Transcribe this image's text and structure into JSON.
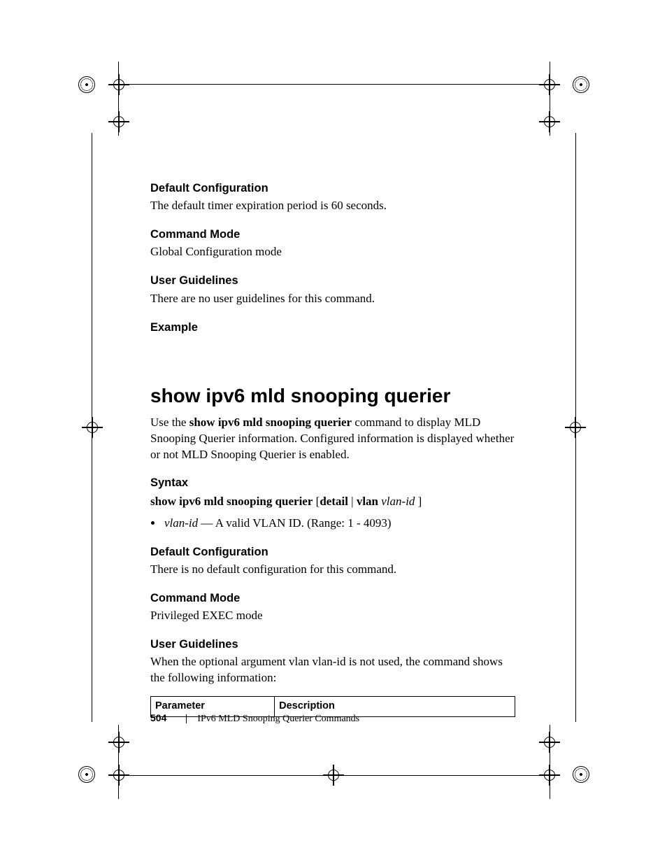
{
  "sections": {
    "default_cfg1_h": "Default Configuration",
    "default_cfg1_p": "The default timer expiration period is 60 seconds.",
    "cmd_mode1_h": "Command Mode",
    "cmd_mode1_p": "Global Configuration mode",
    "user_gl1_h": "User Guidelines",
    "user_gl1_p": "There are no user guidelines for this command.",
    "example_h": "Example"
  },
  "command": {
    "title": "show ipv6 mld snooping querier",
    "desc_pre": "Use the ",
    "desc_bold": "show ipv6 mld snooping querier",
    "desc_post": " command to display MLD Snooping Querier information. Configured information is displayed whether or not MLD Snooping Querier is enabled."
  },
  "syntax": {
    "heading": "Syntax",
    "line_bold1": "show ipv6 mld snooping querier",
    "line_plain1": " [",
    "line_bold2": "detail",
    "line_plain2": " | ",
    "line_bold3": "vlan",
    "line_plain3": " ",
    "line_ital": "vlan-id",
    "line_plain4": " ]",
    "bullet_term": "vlan-id",
    "bullet_dash": " — ",
    "bullet_rest": "A valid VLAN ID. (Range: 1 - 4093)"
  },
  "sections2": {
    "default_cfg2_h": "Default Configuration",
    "default_cfg2_p": "There is no default configuration for this command.",
    "cmd_mode2_h": "Command Mode",
    "cmd_mode2_p": "Privileged EXEC mode",
    "user_gl2_h": "User Guidelines",
    "user_gl2_p": "When the optional argument vlan vlan-id is not used, the command shows the following information:"
  },
  "table": {
    "col1": "Parameter",
    "col2": "Description"
  },
  "footer": {
    "page_number": "504",
    "chapter": "IPv6 MLD Snooping Querier Commands"
  }
}
